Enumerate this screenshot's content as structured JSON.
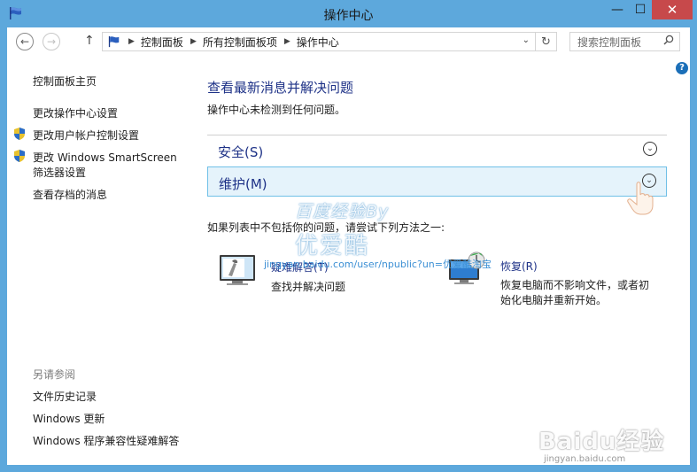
{
  "window": {
    "title": "操作中心",
    "minimize_glyph": "—",
    "maximize_glyph": "☐",
    "close_glyph": "✕"
  },
  "navbar": {
    "back_glyph": "←",
    "forward_glyph": "→",
    "up_glyph": "↑",
    "breadcrumbs": [
      "控制面板",
      "所有控制面板项",
      "操作中心"
    ],
    "dropdown_glyph": "⌄",
    "refresh_glyph": "↻",
    "search_placeholder": "搜索控制面板"
  },
  "help": {
    "glyph": "?"
  },
  "sidebar": {
    "home_link": "控制面板主页",
    "links": [
      "更改操作中心设置",
      "更改用户帐户控制设置",
      "更改 Windows SmartScreen",
      "筛选器设置",
      "查看存档的消息"
    ],
    "see_also_label": "另请参阅",
    "see_also_links": [
      "文件历史记录",
      "Windows 更新",
      "Windows 程序兼容性疑难解答"
    ]
  },
  "main": {
    "heading": "查看最新消息并解决问题",
    "status": "操作中心未检测到任何问题。",
    "sections": [
      {
        "label": "安全(S)",
        "expanded": false
      },
      {
        "label": "维护(M)",
        "expanded": false,
        "hovered": true
      }
    ],
    "chevron_glyph": "⌄",
    "if_text": "如果列表中不包括你的问题，请尝试下列方法之一:",
    "tools": [
      {
        "title": "疑难解答(T)",
        "description": "查找并解决问题",
        "icon": "troubleshoot-icon"
      },
      {
        "title": "恢复(R)",
        "description": "恢复电脑而不影响文件，或者初始化电脑并重新开始。",
        "icon": "recovery-icon"
      }
    ]
  },
  "watermarks": {
    "jingyan_cn": "百度经验By",
    "jingyan_logo": "优爱酷",
    "jingyan_url": "jingyan.baidu.com/user/npublic?un=优爱酷淘宝",
    "baidu_text": "Baidu经验",
    "baidu_url": "jingyan.baidu.com"
  },
  "colors": {
    "frame": "#5da8dc",
    "close_button": "#c7494b",
    "heading_blue": "#1e3287",
    "hover_bg": "#e5f3fb",
    "hover_border": "#70c0e7"
  }
}
